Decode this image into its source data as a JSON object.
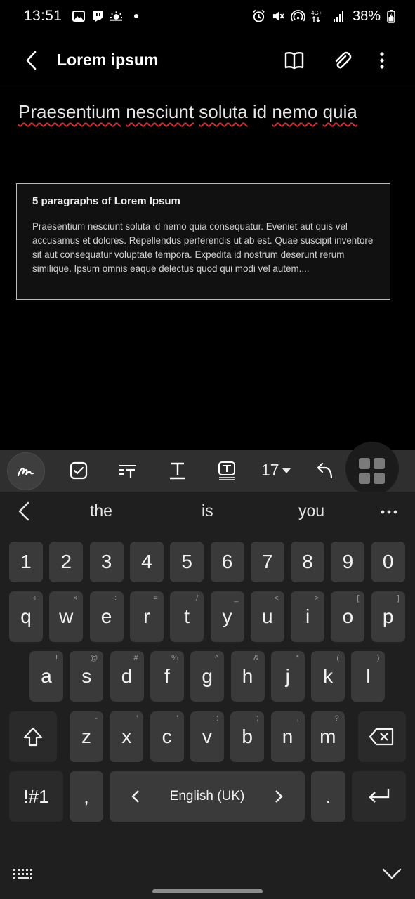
{
  "status_bar": {
    "time": "13:51",
    "battery": "38%",
    "network": "4G+"
  },
  "header": {
    "title": "Lorem ipsum"
  },
  "note": {
    "title_words": [
      "Praesentium",
      "nesciunt",
      "soluta",
      "id",
      "nemo",
      "quia"
    ],
    "card": {
      "title": "5 paragraphs of Lorem Ipsum",
      "body": "Praesentium nesciunt soluta id nemo quia consequatur. Eveniet aut quis vel accusamus et dolores. Repellendus perferendis ut ab est. Quae suscipit inventore sit aut consequatur voluptate tempora. Expedita id nostrum deserunt rerum similique. Ipsum omnis eaque delectus quod qui modi vel autem...."
    }
  },
  "toolbar": {
    "font_size": "17"
  },
  "keyboard": {
    "predictions": [
      "the",
      "is",
      "you"
    ],
    "number_row": [
      "1",
      "2",
      "3",
      "4",
      "5",
      "6",
      "7",
      "8",
      "9",
      "0"
    ],
    "row1": [
      {
        "k": "q",
        "s": "+"
      },
      {
        "k": "w",
        "s": "×"
      },
      {
        "k": "e",
        "s": "÷"
      },
      {
        "k": "r",
        "s": "="
      },
      {
        "k": "t",
        "s": "/"
      },
      {
        "k": "y",
        "s": "_"
      },
      {
        "k": "u",
        "s": "<"
      },
      {
        "k": "i",
        "s": ">"
      },
      {
        "k": "o",
        "s": "["
      },
      {
        "k": "p",
        "s": "]"
      }
    ],
    "row2": [
      {
        "k": "a",
        "s": "!"
      },
      {
        "k": "s",
        "s": "@"
      },
      {
        "k": "d",
        "s": "#"
      },
      {
        "k": "f",
        "s": "%"
      },
      {
        "k": "g",
        "s": "^"
      },
      {
        "k": "h",
        "s": "&"
      },
      {
        "k": "j",
        "s": "*"
      },
      {
        "k": "k",
        "s": "("
      },
      {
        "k": "l",
        "s": ")"
      }
    ],
    "row3": [
      {
        "k": "z",
        "s": "-"
      },
      {
        "k": "x",
        "s": "'"
      },
      {
        "k": "c",
        "s": "\""
      },
      {
        "k": "v",
        "s": ":"
      },
      {
        "k": "b",
        "s": ";"
      },
      {
        "k": "n",
        "s": ","
      },
      {
        "k": "m",
        "s": "?"
      }
    ],
    "symbols_label": "!#1",
    "comma_label": ",",
    "space_label": "English (UK)",
    "period_label": "."
  },
  "colors": {
    "background": "#000000",
    "keyboard": "#1f1f1f",
    "key": "#3a3a3a",
    "toolbar": "#2f2f2f",
    "spellcheck": "#d32f2f"
  }
}
